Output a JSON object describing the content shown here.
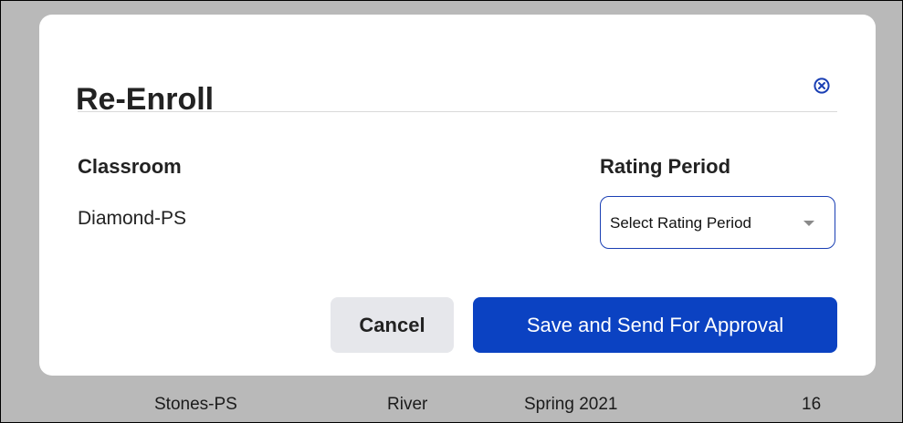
{
  "background_table": {
    "row": {
      "classroom": "Stones-PS",
      "location": "River",
      "period": "Spring 2021",
      "count": "16"
    }
  },
  "modal": {
    "title": "Re-Enroll",
    "close_icon": "close-circle-icon",
    "classroom_label": "Classroom",
    "classroom_value": "Diamond-PS",
    "rating_period_label": "Rating Period",
    "rating_period_select": {
      "selected": "Select Rating Period",
      "icon": "chevron-down-icon"
    },
    "cancel_label": "Cancel",
    "save_label": "Save and Send For Approval"
  },
  "colors": {
    "overlay": "#b9b9b9",
    "primary": "#0b42c2",
    "select_border": "#1a3fb4",
    "close_icon": "#1a3fb4",
    "cancel_bg": "#e6e7eb"
  }
}
